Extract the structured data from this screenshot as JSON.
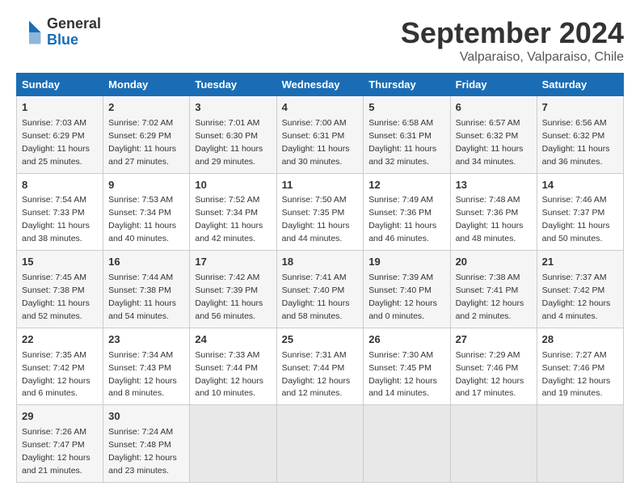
{
  "logo": {
    "general": "General",
    "blue": "Blue"
  },
  "header": {
    "month": "September 2024",
    "location": "Valparaiso, Valparaiso, Chile"
  },
  "weekdays": [
    "Sunday",
    "Monday",
    "Tuesday",
    "Wednesday",
    "Thursday",
    "Friday",
    "Saturday"
  ],
  "weeks": [
    [
      {
        "day": "1",
        "sunrise": "7:03 AM",
        "sunset": "6:29 PM",
        "daylight": "11 hours and 25 minutes."
      },
      {
        "day": "2",
        "sunrise": "7:02 AM",
        "sunset": "6:29 PM",
        "daylight": "11 hours and 27 minutes."
      },
      {
        "day": "3",
        "sunrise": "7:01 AM",
        "sunset": "6:30 PM",
        "daylight": "11 hours and 29 minutes."
      },
      {
        "day": "4",
        "sunrise": "7:00 AM",
        "sunset": "6:31 PM",
        "daylight": "11 hours and 30 minutes."
      },
      {
        "day": "5",
        "sunrise": "6:58 AM",
        "sunset": "6:31 PM",
        "daylight": "11 hours and 32 minutes."
      },
      {
        "day": "6",
        "sunrise": "6:57 AM",
        "sunset": "6:32 PM",
        "daylight": "11 hours and 34 minutes."
      },
      {
        "day": "7",
        "sunrise": "6:56 AM",
        "sunset": "6:32 PM",
        "daylight": "11 hours and 36 minutes."
      }
    ],
    [
      {
        "day": "8",
        "sunrise": "7:54 AM",
        "sunset": "7:33 PM",
        "daylight": "11 hours and 38 minutes."
      },
      {
        "day": "9",
        "sunrise": "7:53 AM",
        "sunset": "7:34 PM",
        "daylight": "11 hours and 40 minutes."
      },
      {
        "day": "10",
        "sunrise": "7:52 AM",
        "sunset": "7:34 PM",
        "daylight": "11 hours and 42 minutes."
      },
      {
        "day": "11",
        "sunrise": "7:50 AM",
        "sunset": "7:35 PM",
        "daylight": "11 hours and 44 minutes."
      },
      {
        "day": "12",
        "sunrise": "7:49 AM",
        "sunset": "7:36 PM",
        "daylight": "11 hours and 46 minutes."
      },
      {
        "day": "13",
        "sunrise": "7:48 AM",
        "sunset": "7:36 PM",
        "daylight": "11 hours and 48 minutes."
      },
      {
        "day": "14",
        "sunrise": "7:46 AM",
        "sunset": "7:37 PM",
        "daylight": "11 hours and 50 minutes."
      }
    ],
    [
      {
        "day": "15",
        "sunrise": "7:45 AM",
        "sunset": "7:38 PM",
        "daylight": "11 hours and 52 minutes."
      },
      {
        "day": "16",
        "sunrise": "7:44 AM",
        "sunset": "7:38 PM",
        "daylight": "11 hours and 54 minutes."
      },
      {
        "day": "17",
        "sunrise": "7:42 AM",
        "sunset": "7:39 PM",
        "daylight": "11 hours and 56 minutes."
      },
      {
        "day": "18",
        "sunrise": "7:41 AM",
        "sunset": "7:40 PM",
        "daylight": "11 hours and 58 minutes."
      },
      {
        "day": "19",
        "sunrise": "7:39 AM",
        "sunset": "7:40 PM",
        "daylight": "12 hours and 0 minutes."
      },
      {
        "day": "20",
        "sunrise": "7:38 AM",
        "sunset": "7:41 PM",
        "daylight": "12 hours and 2 minutes."
      },
      {
        "day": "21",
        "sunrise": "7:37 AM",
        "sunset": "7:42 PM",
        "daylight": "12 hours and 4 minutes."
      }
    ],
    [
      {
        "day": "22",
        "sunrise": "7:35 AM",
        "sunset": "7:42 PM",
        "daylight": "12 hours and 6 minutes."
      },
      {
        "day": "23",
        "sunrise": "7:34 AM",
        "sunset": "7:43 PM",
        "daylight": "12 hours and 8 minutes."
      },
      {
        "day": "24",
        "sunrise": "7:33 AM",
        "sunset": "7:44 PM",
        "daylight": "12 hours and 10 minutes."
      },
      {
        "day": "25",
        "sunrise": "7:31 AM",
        "sunset": "7:44 PM",
        "daylight": "12 hours and 12 minutes."
      },
      {
        "day": "26",
        "sunrise": "7:30 AM",
        "sunset": "7:45 PM",
        "daylight": "12 hours and 14 minutes."
      },
      {
        "day": "27",
        "sunrise": "7:29 AM",
        "sunset": "7:46 PM",
        "daylight": "12 hours and 17 minutes."
      },
      {
        "day": "28",
        "sunrise": "7:27 AM",
        "sunset": "7:46 PM",
        "daylight": "12 hours and 19 minutes."
      }
    ],
    [
      {
        "day": "29",
        "sunrise": "7:26 AM",
        "sunset": "7:47 PM",
        "daylight": "12 hours and 21 minutes."
      },
      {
        "day": "30",
        "sunrise": "7:24 AM",
        "sunset": "7:48 PM",
        "daylight": "12 hours and 23 minutes."
      },
      null,
      null,
      null,
      null,
      null
    ]
  ]
}
